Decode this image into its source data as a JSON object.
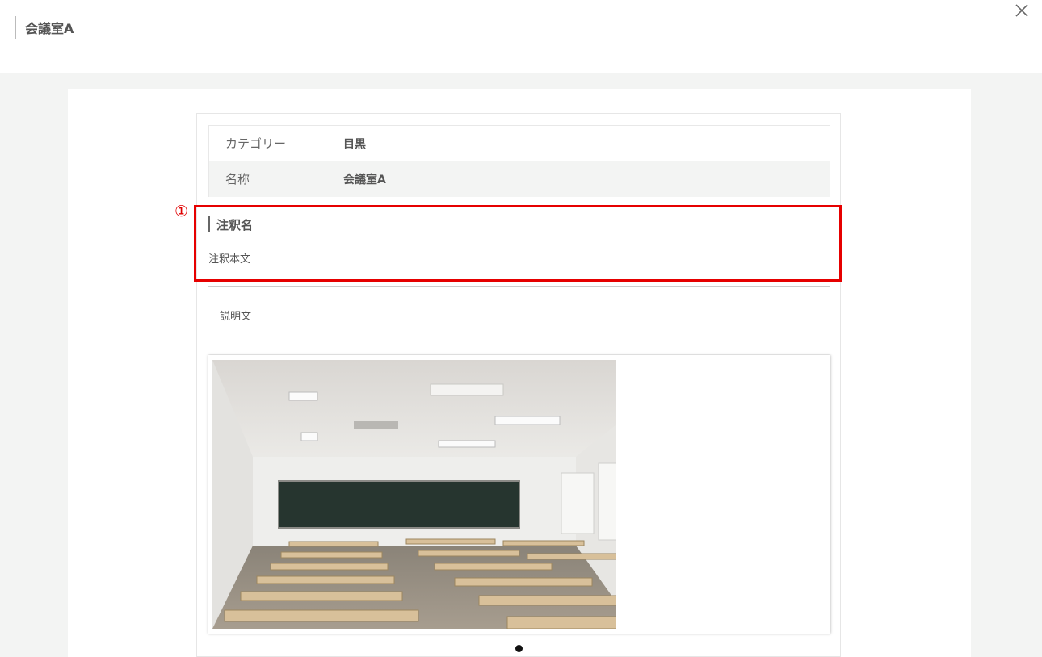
{
  "header": {
    "title": "会議室A",
    "close_icon": "close-icon"
  },
  "info": {
    "rows": [
      {
        "label": "カテゴリー",
        "value": "目黒"
      },
      {
        "label": "名称",
        "value": "会議室A"
      }
    ]
  },
  "annotation": {
    "marker": "①",
    "color": "#e60000"
  },
  "note": {
    "title": "注釈名",
    "body": "注釈本文"
  },
  "description": "説明文",
  "gallery": {
    "image_subject": "classroom-photo",
    "pagination": {
      "count": 1,
      "active": 0
    }
  }
}
